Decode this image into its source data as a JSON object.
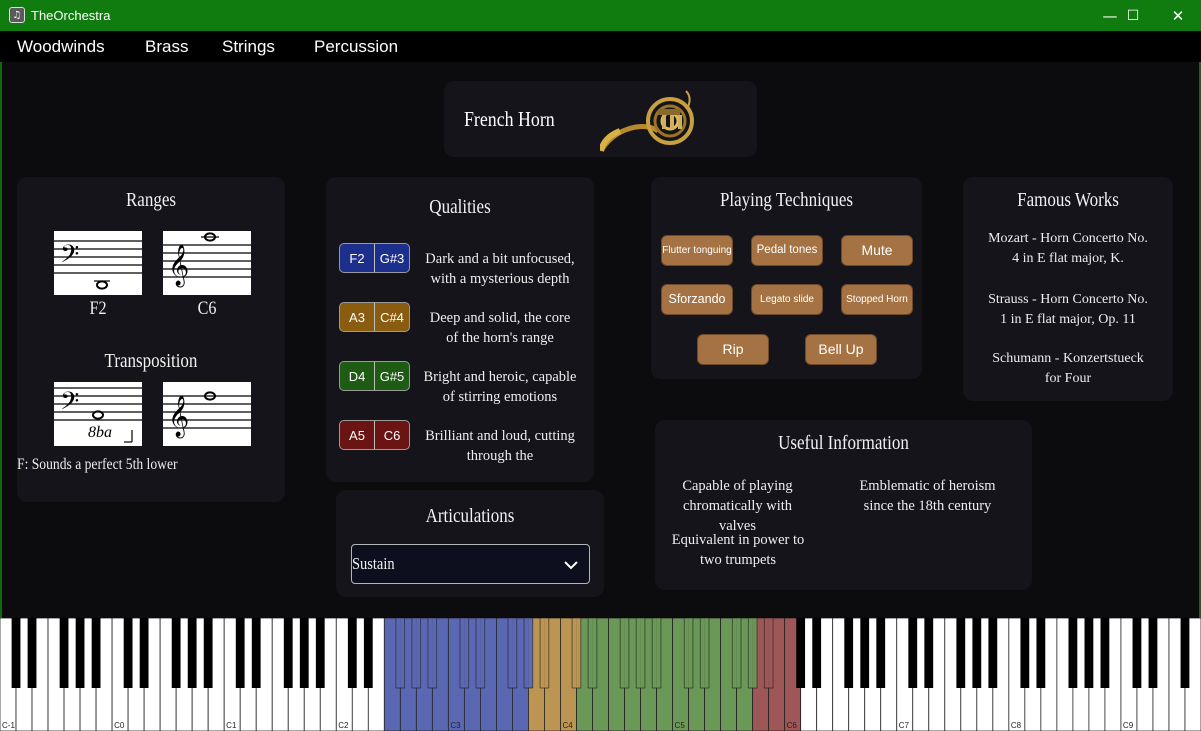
{
  "window": {
    "title": "TheOrchestra",
    "minimize": "—",
    "maximize": "☐",
    "close": "✕"
  },
  "menu": [
    "Woodwinds",
    "Brass",
    "Strings",
    "Percussion"
  ],
  "instrument": {
    "name": "French Horn"
  },
  "ranges": {
    "title": "Ranges",
    "low": "F2",
    "high": "C6"
  },
  "transposition": {
    "title": "Transposition",
    "octave_mark": "8ba",
    "note": "F: Sounds a perfect 5th lower"
  },
  "qualities": {
    "title": "Qualities",
    "items": [
      {
        "from": "F2",
        "to": "G#3",
        "color": "#1c2f8c",
        "text": "Dark and a bit unfocused, with a mysterious depth"
      },
      {
        "from": "A3",
        "to": "C#4",
        "color": "#8a5c10",
        "text": "Deep and solid, the core of the horn's range"
      },
      {
        "from": "D4",
        "to": "G#5",
        "color": "#1d5c12",
        "text": "Bright and heroic, capable of stirring emotions"
      },
      {
        "from": "A5",
        "to": "C6",
        "color": "#6a1414",
        "text": "Brilliant and loud, cutting through the"
      }
    ]
  },
  "articulations": {
    "title": "Articulations",
    "selected": "Sustain"
  },
  "techniques": {
    "title": "Playing Techniques",
    "buttons": [
      "Flutter tonguing",
      "Pedal tones",
      "Mute",
      "Sforzando",
      "Legato slide",
      "Stopped Horn",
      "Rip",
      "Bell Up"
    ]
  },
  "famous_works": {
    "title": "Famous Works",
    "items": [
      "Mozart - Horn Concerto No. 4 in E flat major, K.",
      "Strauss - Horn Concerto No. 1 in E flat major, Op. 11",
      "Schumann - Konzertstueck for Four"
    ]
  },
  "useful_info": {
    "title": "Useful Information",
    "items": [
      "Capable of playing chromatically with valves",
      "Emblematic of heroism since the 18th century",
      "Equivalent in power to two trumpets"
    ]
  },
  "keyboard": {
    "octave_labels": [
      "C-1",
      "C0",
      "C1",
      "C2",
      "C3",
      "C4",
      "C5",
      "C6",
      "C7",
      "C8",
      "C9"
    ],
    "zones": [
      {
        "from": "F2",
        "to": "G#3",
        "color": "#5a68b4"
      },
      {
        "from": "A3",
        "to": "C#4",
        "color": "#bd9552"
      },
      {
        "from": "D4",
        "to": "G#5",
        "color": "#6a9857"
      },
      {
        "from": "A5",
        "to": "C6",
        "color": "#9e5656"
      }
    ]
  }
}
